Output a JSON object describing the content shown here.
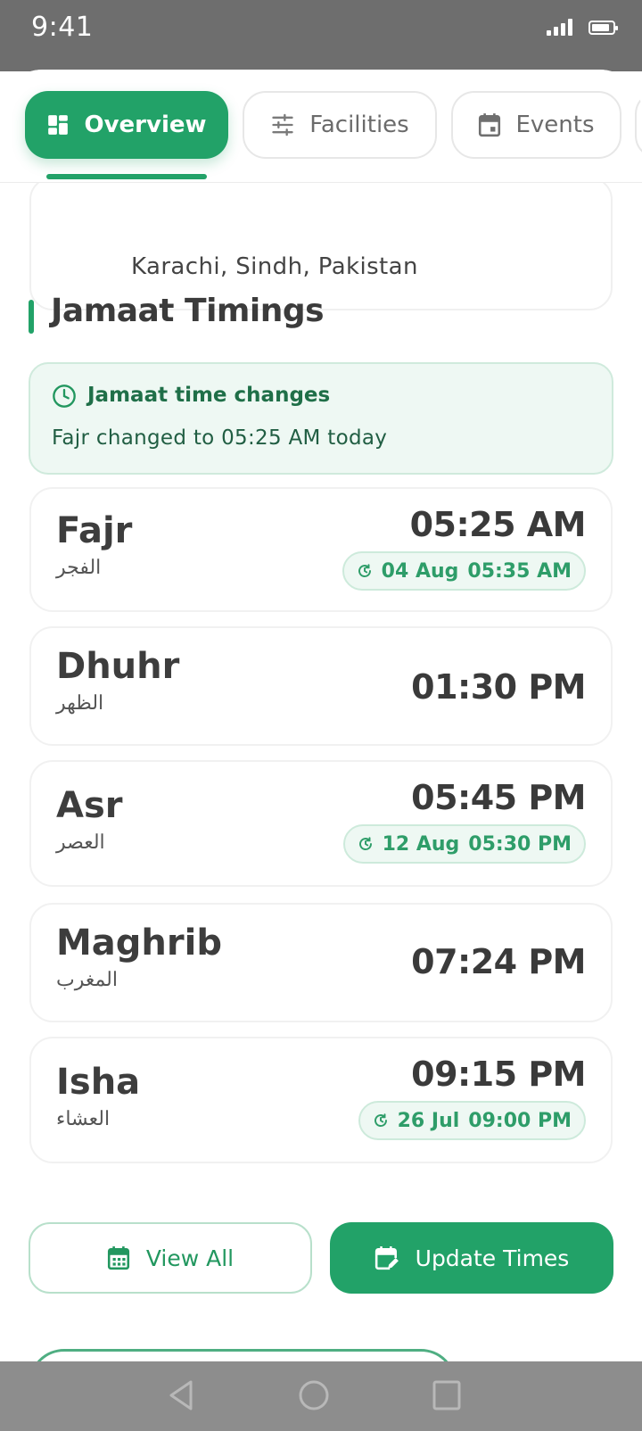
{
  "status_bar": {
    "time": "9:41",
    "icons": [
      "signal-icon",
      "battery-icon"
    ]
  },
  "tabs": [
    {
      "label": "Overview",
      "icon": "dashboard-icon",
      "active": true
    },
    {
      "label": "Facilities",
      "icon": "sliders-icon",
      "active": false
    },
    {
      "label": "Events",
      "icon": "calendar-icon",
      "active": false
    }
  ],
  "address": {
    "line": "Karachi, Sindh, Pakistan"
  },
  "section": {
    "title": "Jamaat Timings"
  },
  "notice": {
    "title": "Jamaat time changes",
    "text": "Fajr changed to 05:25 AM today",
    "icon": "clock-icon"
  },
  "prayers": [
    {
      "name": "Fajr",
      "arabic": "الفجر",
      "time": "05:25 AM",
      "change_date": "04 Aug",
      "change_time": "05:35 AM"
    },
    {
      "name": "Dhuhr",
      "arabic": "الظهر",
      "time": "01:30 PM"
    },
    {
      "name": "Asr",
      "arabic": "العصر",
      "time": "05:45 PM",
      "change_date": "12 Aug",
      "change_time": "05:30 PM"
    },
    {
      "name": "Maghrib",
      "arabic": "المغرب",
      "time": "07:24 PM"
    },
    {
      "name": "Isha",
      "arabic": "العشاء",
      "time": "09:15 PM",
      "change_date": "26 Jul",
      "change_time": "09:00 PM"
    }
  ],
  "actions": {
    "view_all": "View All",
    "update_times": "Update Times"
  },
  "colors": {
    "accent": "#22a268",
    "notice_bg": "#eef8f3",
    "text_dark": "#3d3d3d"
  },
  "nav": {
    "icons": [
      "back-icon",
      "home-icon",
      "recents-icon"
    ]
  }
}
